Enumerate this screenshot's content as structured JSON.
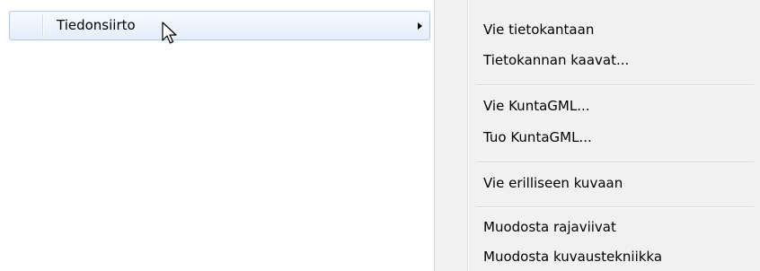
{
  "context_menu": {
    "active_item": {
      "label": "Tiedonsiirto",
      "has_submenu": true,
      "submenu_arrow_icon": "chevron-right-icon"
    }
  },
  "submenu": {
    "groups": [
      [
        "Vie tietokantaan",
        "Tietokannan kaavat..."
      ],
      [
        "Vie KuntaGML...",
        "Tuo KuntaGML..."
      ],
      [
        "Vie erilliseen kuvaan"
      ],
      [
        "Muodosta rajaviivat",
        "Muodosta kuvaustekniikka"
      ]
    ]
  },
  "cursor": {
    "icon": "arrow-pointer-icon"
  }
}
